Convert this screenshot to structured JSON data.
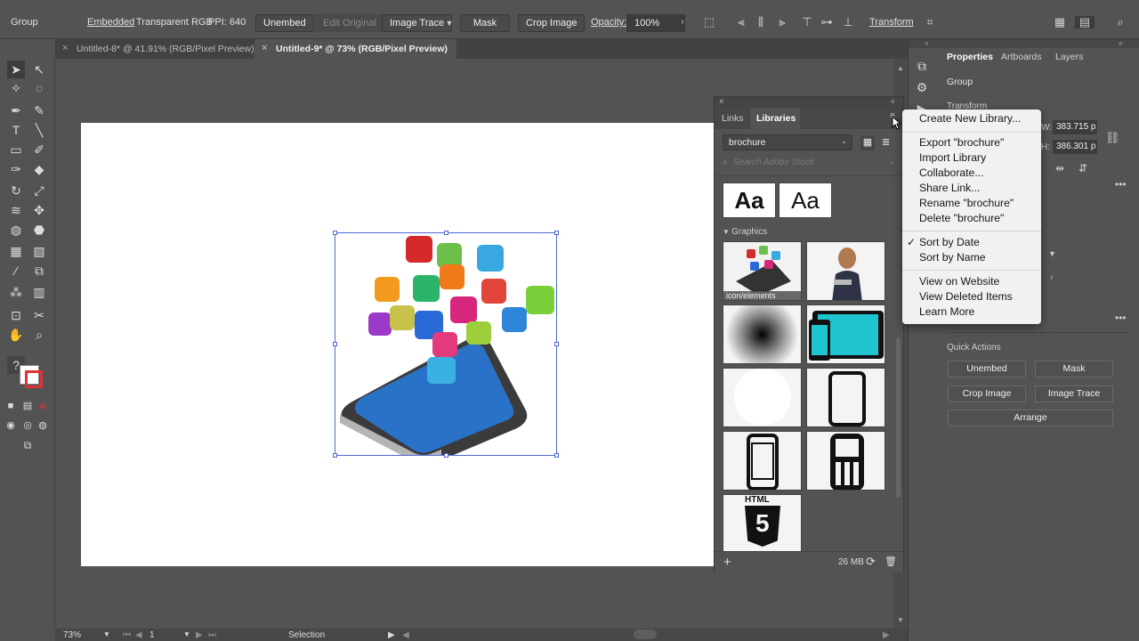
{
  "control_bar": {
    "selection_type": "Group",
    "embedded": "Embedded",
    "color_mode": "Transparent RGB",
    "ppi": "PPI: 640",
    "unembed": "Unembed",
    "edit_original": "Edit Original",
    "image_trace": "Image Trace",
    "mask": "Mask",
    "crop_image": "Crop Image",
    "opacity_label": "Opacity:",
    "opacity_value": "100%",
    "transform": "Transform"
  },
  "tabs": [
    {
      "label": "Untitled-8* @ 41.91% (RGB/Pixel Preview)",
      "active": false
    },
    {
      "label": "Untitled-9* @ 73% (RGB/Pixel Preview)",
      "active": true
    }
  ],
  "status_bar": {
    "zoom": "73%",
    "artboard": "1",
    "tool": "Selection"
  },
  "properties_panel": {
    "tabs": [
      "Properties",
      "Artboards",
      "Layers"
    ],
    "selection": "Group",
    "transform_heading": "Transform",
    "w_label": "W:",
    "w_value": "383.715 p",
    "h_label": "H:",
    "h_value": "386.301 p",
    "quick_actions_heading": "Quick Actions",
    "quick_actions": [
      "Unembed",
      "Mask",
      "Crop Image",
      "Image Trace",
      "Arrange"
    ]
  },
  "libraries_panel": {
    "tabs": [
      "Links",
      "Libraries"
    ],
    "library_name": "brochure",
    "search_placeholder": "Search Adobe Stock",
    "char_style_sample": "Aa",
    "graphics_heading": "Graphics",
    "first_graphic_label": "icon/elements",
    "html5_text": "HTML",
    "html5_digit": "5",
    "storage": "26 MB"
  },
  "flyout_menu": {
    "items": [
      {
        "label": "Create New Library...",
        "checked": false
      },
      {
        "label": "Export \"brochure\"",
        "checked": false
      },
      {
        "label": "Import Library",
        "checked": false
      },
      {
        "label": "Collaborate...",
        "checked": false
      },
      {
        "label": "Share Link...",
        "checked": false
      },
      {
        "label": "Rename \"brochure\"",
        "checked": false
      },
      {
        "label": "Delete \"brochure\"",
        "checked": false
      },
      {
        "label": "Sort by Date",
        "checked": true
      },
      {
        "label": "Sort by Name",
        "checked": false
      },
      {
        "label": "View on Website",
        "checked": false
      },
      {
        "label": "View Deleted Items",
        "checked": false
      },
      {
        "label": "Learn More",
        "checked": false
      }
    ],
    "check_mark": "✓"
  },
  "colors": {
    "accent": "#4b6bd3",
    "panel": "#535353",
    "menu_bg": "#f1f1f1"
  }
}
